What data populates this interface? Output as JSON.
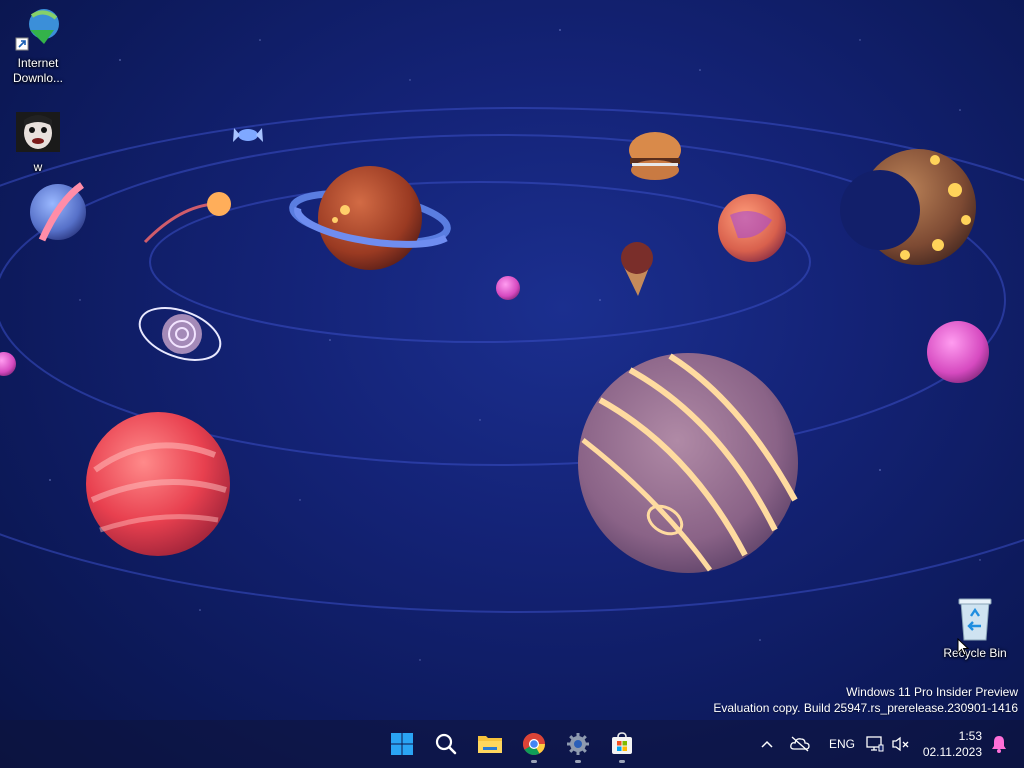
{
  "desktop": {
    "icons": [
      {
        "label": "Internet\nDownlo...",
        "icon": "internet-download-manager-icon"
      },
      {
        "label": "w",
        "icon": "face-thumbnail-icon"
      },
      {
        "label": "Recycle Bin",
        "icon": "recycle-bin-icon"
      }
    ],
    "wallpaper": "candy-planets-space",
    "colors": {
      "space_dark": "#0d1a5c",
      "space_mid": "#142377",
      "orbit": "#3b4ec4"
    }
  },
  "watermark": {
    "line1": "Windows 11 Pro Insider Preview",
    "line2": "Evaluation copy. Build 25947.rs_prerelease.230901-1416"
  },
  "taskbar": {
    "apps": [
      {
        "icon": "windows-start-icon",
        "running": false
      },
      {
        "icon": "search-icon",
        "running": false
      },
      {
        "icon": "file-explorer-icon",
        "running": false
      },
      {
        "icon": "chrome-icon",
        "running": true
      },
      {
        "icon": "settings-gear-icon",
        "running": true
      },
      {
        "icon": "microsoft-store-icon",
        "running": true
      }
    ],
    "tray": {
      "chevron_icon": "chevron-up-icon",
      "onedrive_icon": "cloud-offline-icon",
      "language": "ENG",
      "network_icon": "network-monitor-icon",
      "volume_icon": "speaker-muted-icon",
      "time": "1:53",
      "date": "02.11.2023",
      "notification_icon": "bell-icon",
      "accent": "#ff6fd8"
    }
  }
}
